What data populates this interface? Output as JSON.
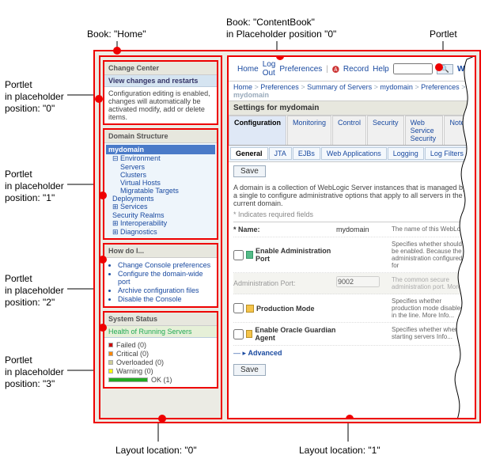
{
  "annotations": {
    "book_home": "Book: \"Home\"",
    "book_content": "Book: \"ContentBook\"\nin Placeholder position \"0\"",
    "portlet": "Portlet",
    "p0": "Portlet\nin placeholder\nposition: \"0\"",
    "p1": "Portlet\nin placeholder\nposition: \"1\"",
    "p2": "Portlet\nin placeholder\nposition: \"2\"",
    "p3": "Portlet\nin placeholder\nposition: \"3\"",
    "layout0": "Layout location: \"0\"",
    "layout1": "Layout location: \"1\""
  },
  "change_center": {
    "title": "Change Center",
    "link": "View changes and restarts",
    "body": "Configuration editing is enabled, changes will automatically be activated modify, add or delete items."
  },
  "domain_structure": {
    "title": "Domain Structure",
    "domain": "mydomain",
    "items": {
      "env": "Environment",
      "servers": "Servers",
      "clusters": "Clusters",
      "vhosts": "Virtual Hosts",
      "migr": "Migratable Targets",
      "deploy": "Deployments",
      "services": "Services",
      "realms": "Security Realms",
      "interop": "Interoperability",
      "diag": "Diagnostics"
    }
  },
  "howdoi": {
    "title": "How do I...",
    "items": [
      "Change Console preferences",
      "Configure the domain-wide port",
      "Archive configuration files",
      "Disable the Console"
    ]
  },
  "system_status": {
    "title": "System Status",
    "sub": "Health of Running Servers",
    "rows": {
      "failed": "Failed (0)",
      "critical": "Critical (0)",
      "overloaded": "Overloaded (0)",
      "warning": "Warning (0)",
      "ok": "OK (1)"
    }
  },
  "toolbar": {
    "home": "Home",
    "logout": "Log Out",
    "prefs": "Preferences",
    "record": "Record",
    "help": "Help",
    "search_placeholder": "",
    "welcome": "Welcome"
  },
  "breadcrumb": {
    "b1": "Home",
    "b2": "Preferences",
    "b3": "Summary of Servers",
    "b4": "mydomain",
    "b5": "Preferences",
    "b6": "mydomain"
  },
  "settings": {
    "title": "Settings for mydomain",
    "tabs": {
      "config": "Configuration",
      "monitoring": "Monitoring",
      "control": "Control",
      "security": "Security",
      "wss": "Web Service Security",
      "notes": "Notes"
    },
    "subtabs": {
      "general": "General",
      "jta": "JTA",
      "ejbs": "EJBs",
      "webapps": "Web Applications",
      "logging": "Logging",
      "logfilters": "Log Filters"
    },
    "save": "Save",
    "desc": "A domain is a collection of WebLogic Server instances that is managed by a single to configure administrative options that apply to all servers in the current domain.",
    "req": "* Indicates required fields",
    "rows": {
      "name_label": "* Name:",
      "name_value": "mydomain",
      "name_help": "The name of this WebLogic",
      "admin_port_label": "Enable Administration Port",
      "admin_port_help": "Specifies whether should be enabled. Because the administration configured for",
      "admin_port_field_label": "Administration Port:",
      "admin_port_field_value": "9002",
      "admin_port_field_help": "The common secure administration port.  More",
      "prod_mode_label": "Production Mode",
      "prod_mode_help": "Specifies whether production mode disabled in the line.  More Info...",
      "guardian_label": "Enable Oracle Guardian Agent",
      "guardian_help": "Specifies whether when starting servers Info..."
    },
    "advanced": "Advanced"
  }
}
